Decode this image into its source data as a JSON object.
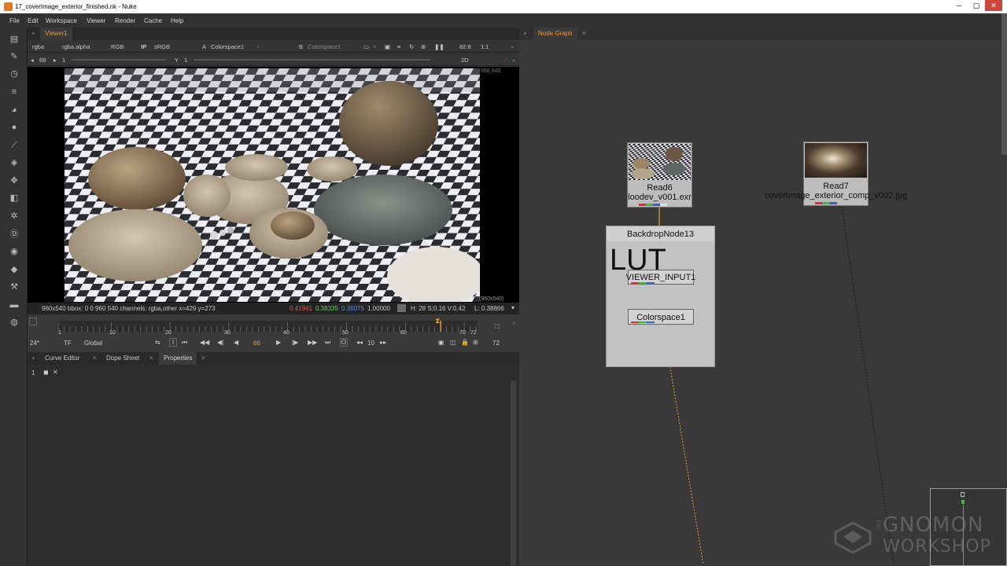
{
  "window": {
    "title": "17_coverImage_exterior_finished.nk - Nuke",
    "min_glyph": "─",
    "max_glyph": "▢",
    "close_glyph": "✕"
  },
  "menu": [
    "File",
    "Edit",
    "Workspace",
    "Viewer",
    "Render",
    "Cache",
    "Help"
  ],
  "tools": [
    "grid-icon",
    "brush-icon",
    "clock-icon",
    "list-icon",
    "palette-icon",
    "circle-icon",
    "curve-icon",
    "layers-icon",
    "move-icon",
    "cube-icon",
    "particles-icon",
    "d-icon",
    "eye-icon",
    "tag-icon",
    "wrench-icon",
    "stack-icon",
    "gauge-icon"
  ],
  "viewer": {
    "tab_label": "Viewer1",
    "row1": {
      "channels": "rgba",
      "alpha": "rgba.alpha",
      "display": "RGB",
      "ip": "IP",
      "lut": "sRGB",
      "a_label": "A",
      "a_input": "Colorspace1",
      "a_op": "-",
      "b_label": "B",
      "b_input": "Colorspace1",
      "zoom": "82.6",
      "proxy": "1:1"
    },
    "row2": {
      "fstop": "f/8",
      "frame_field": "1",
      "y_label": "Y",
      "y_value": "1",
      "view_mode": "2D"
    },
    "format_label_top": "960,540",
    "format_label_bottom": "(960x540)",
    "info": {
      "left": "960x540    bbox: 0 0 960 540 channels: rgba,other   x=429 y=273",
      "r": "0.41941",
      "g": "0.38335",
      "b": "0.35075",
      "a": "1.00000",
      "hsv": "H: 28 S:0.16 V:0.42",
      "lum": "L: 0.38866"
    }
  },
  "timeline": {
    "ticks": [
      "1",
      "10",
      "20",
      "30",
      "40",
      "50",
      "60",
      "70",
      "72"
    ],
    "end_frame": "72",
    "fps": "24*",
    "tf": "TF",
    "scope": "Global",
    "current_frame": "66",
    "step": "10",
    "out_frame": "72"
  },
  "bottom_panel": {
    "tabs": [
      "Curve Editor",
      "Dope Sheet",
      "Properties"
    ],
    "props_count": "1"
  },
  "node_graph": {
    "tab_label": "Node Graph",
    "read6": {
      "name": "Read6",
      "file": "loodev_v001.exr"
    },
    "read7": {
      "name": "Read7",
      "file": "coverImage_exterior_comp_v002.jpg"
    },
    "backdrop": {
      "name": "BackdropNode13",
      "note": "LUT"
    },
    "viewer_input": "VIEWER_INPUT1",
    "colorspace": "Colorspace1"
  },
  "watermark": {
    "line1": "GNOMON",
    "line2": "WORKSHOP",
    "the": "THE"
  },
  "colors": {
    "accent": "#e89a3c",
    "wire": "#e8a030",
    "backdrop": "#c0c0c0"
  }
}
